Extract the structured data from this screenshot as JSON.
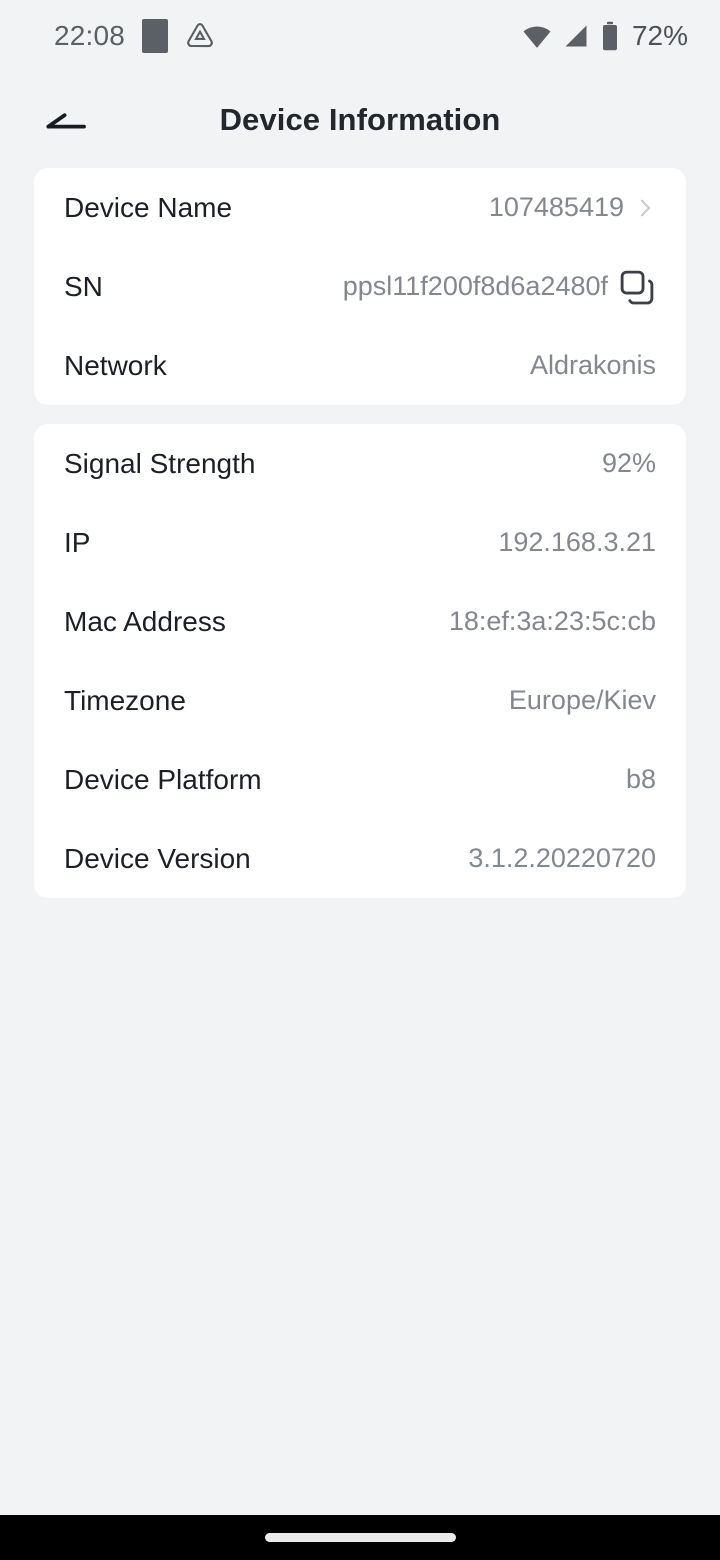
{
  "status_bar": {
    "time": "22:08",
    "battery_percent": "72%",
    "icons": {
      "placeholder_app": "square-icon",
      "notification_app": "triangle-badge-icon",
      "wifi": "wifi-icon",
      "cellular": "signal-icon",
      "battery": "battery-icon"
    }
  },
  "header": {
    "title": "Device Information",
    "back_icon": "back-arrow-icon"
  },
  "cards": [
    {
      "id": "identity-card",
      "rows": [
        {
          "name": "device-name",
          "label": "Device Name",
          "value": "107485419",
          "accessory": "chevron"
        },
        {
          "name": "serial-number",
          "label": "SN",
          "value": "ppsl11f200f8d6a2480f",
          "accessory": "copy"
        },
        {
          "name": "network",
          "label": "Network",
          "value": "Aldrakonis",
          "accessory": "none"
        }
      ]
    },
    {
      "id": "connection-card",
      "rows": [
        {
          "name": "signal-strength",
          "label": "Signal Strength",
          "value": "92%",
          "accessory": "none"
        },
        {
          "name": "ip-address",
          "label": "IP",
          "value": "192.168.3.21",
          "accessory": "none"
        },
        {
          "name": "mac-address",
          "label": "Mac Address",
          "value": "18:ef:3a:23:5c:cb",
          "accessory": "none"
        },
        {
          "name": "timezone",
          "label": "Timezone",
          "value": "Europe/Kiev",
          "accessory": "none"
        },
        {
          "name": "device-platform",
          "label": "Device Platform",
          "value": "b8",
          "accessory": "none"
        },
        {
          "name": "device-version",
          "label": "Device Version",
          "value": "3.1.2.20220720",
          "accessory": "none"
        }
      ]
    }
  ],
  "nav_bar": {
    "home_indicator": "home-indicator"
  },
  "colors": {
    "background": "#f2f3f5",
    "card": "#ffffff",
    "label_text": "#1c1f25",
    "value_text": "#83878e",
    "title_text": "#23262c",
    "status_icon": "#5b5f66",
    "nav_bar": "#000000"
  }
}
